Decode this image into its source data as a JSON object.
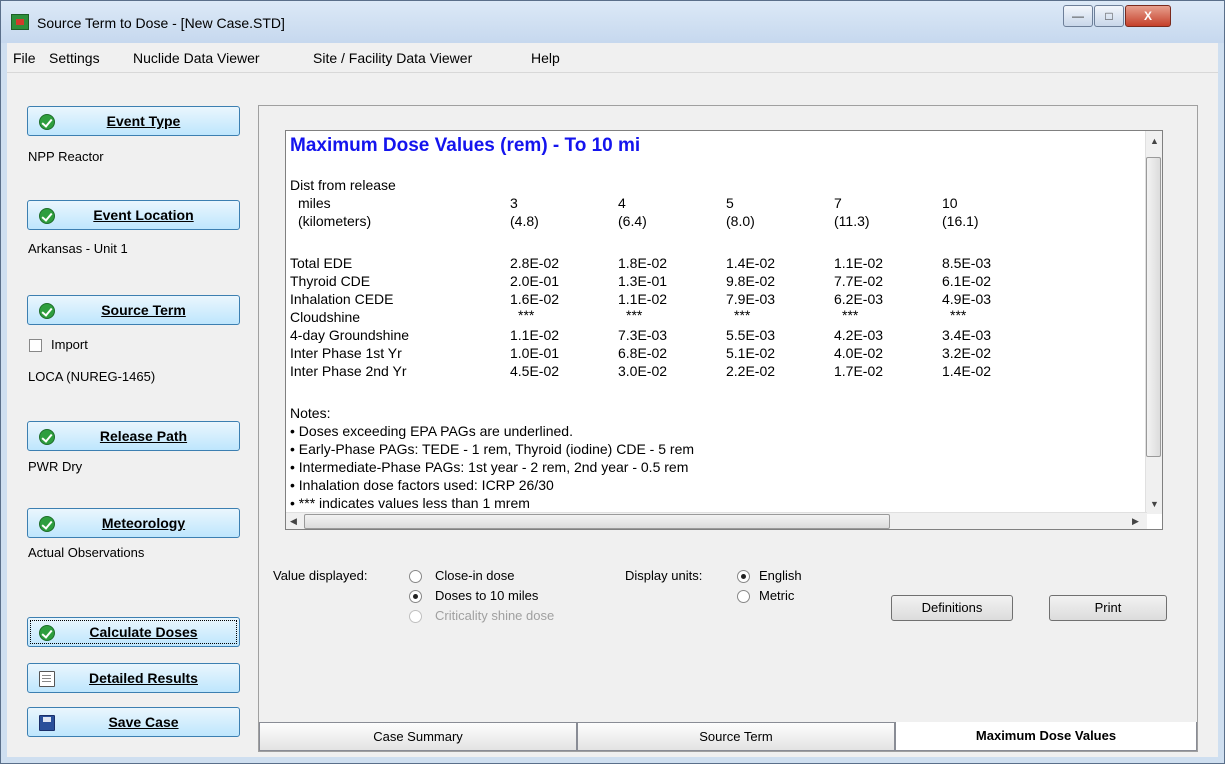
{
  "window": {
    "title": "Source Term to Dose - [New Case.STD]"
  },
  "menu": [
    "File",
    "Settings",
    "Nuclide Data Viewer",
    "Site / Facility Data Viewer",
    "Help"
  ],
  "sidebar": {
    "event_type": {
      "label": "Event Type",
      "value": "NPP Reactor"
    },
    "event_location": {
      "label": "Event Location",
      "value": "Arkansas - Unit 1"
    },
    "source_term": {
      "label": "Source Term",
      "import_label": "Import",
      "value": "LOCA (NUREG-1465)"
    },
    "release_path": {
      "label": "Release Path",
      "value": "PWR Dry"
    },
    "meteorology": {
      "label": "Meteorology",
      "value": "Actual Observations"
    },
    "calculate_label": "Calculate Doses",
    "detailed_label": "Detailed Results",
    "save_label": "Save Case"
  },
  "report": {
    "title": "Maximum Dose Values (rem) - To 10 mi",
    "dist_header": "Dist from release",
    "miles_label": "miles",
    "km_label": "(kilometers)",
    "miles": [
      "3",
      "4",
      "5",
      "7",
      "10"
    ],
    "km": [
      "(4.8)",
      "(6.4)",
      "(8.0)",
      "(11.3)",
      "(16.1)"
    ],
    "rows": [
      {
        "label": "Total EDE",
        "values": [
          "2.8E-02",
          "1.8E-02",
          "1.4E-02",
          "1.1E-02",
          "8.5E-03"
        ]
      },
      {
        "label": "Thyroid CDE",
        "values": [
          "2.0E-01",
          "1.3E-01",
          "9.8E-02",
          "7.7E-02",
          "6.1E-02"
        ]
      },
      {
        "label": "Inhalation CEDE",
        "values": [
          "1.6E-02",
          "1.1E-02",
          "7.9E-03",
          "6.2E-03",
          "4.9E-03"
        ]
      },
      {
        "label": "Cloudshine",
        "values": [
          "***",
          "***",
          "***",
          "***",
          "***"
        ]
      },
      {
        "label": "4-day Groundshine",
        "values": [
          "1.1E-02",
          "7.3E-03",
          "5.5E-03",
          "4.2E-03",
          "3.4E-03"
        ]
      },
      {
        "label": "Inter Phase 1st Yr",
        "values": [
          "1.0E-01",
          "6.8E-02",
          "5.1E-02",
          "4.0E-02",
          "3.2E-02"
        ]
      },
      {
        "label": "Inter Phase 2nd Yr",
        "values": [
          "4.5E-02",
          "3.0E-02",
          "2.2E-02",
          "1.7E-02",
          "1.4E-02"
        ]
      }
    ],
    "notes_header": "Notes:",
    "notes": [
      "• Doses exceeding EPA PAGs are underlined.",
      "• Early-Phase PAGs: TEDE - 1 rem, Thyroid (iodine) CDE - 5 rem",
      "• Intermediate-Phase PAGs: 1st year - 2 rem, 2nd year - 0.5 rem",
      "• Inhalation dose factors used: ICRP 26/30",
      "• *** indicates values less than 1 mrem"
    ]
  },
  "options": {
    "value_label": "Value displayed:",
    "close_in": "Close-in dose",
    "to_10": "Doses to 10 miles",
    "criticality": "Criticality shine dose",
    "units_label": "Display units:",
    "english": "English",
    "metric": "Metric"
  },
  "buttons": {
    "definitions": "Definitions",
    "print": "Print"
  },
  "tabs": [
    "Case Summary",
    "Source Term",
    "Maximum Dose Values"
  ]
}
